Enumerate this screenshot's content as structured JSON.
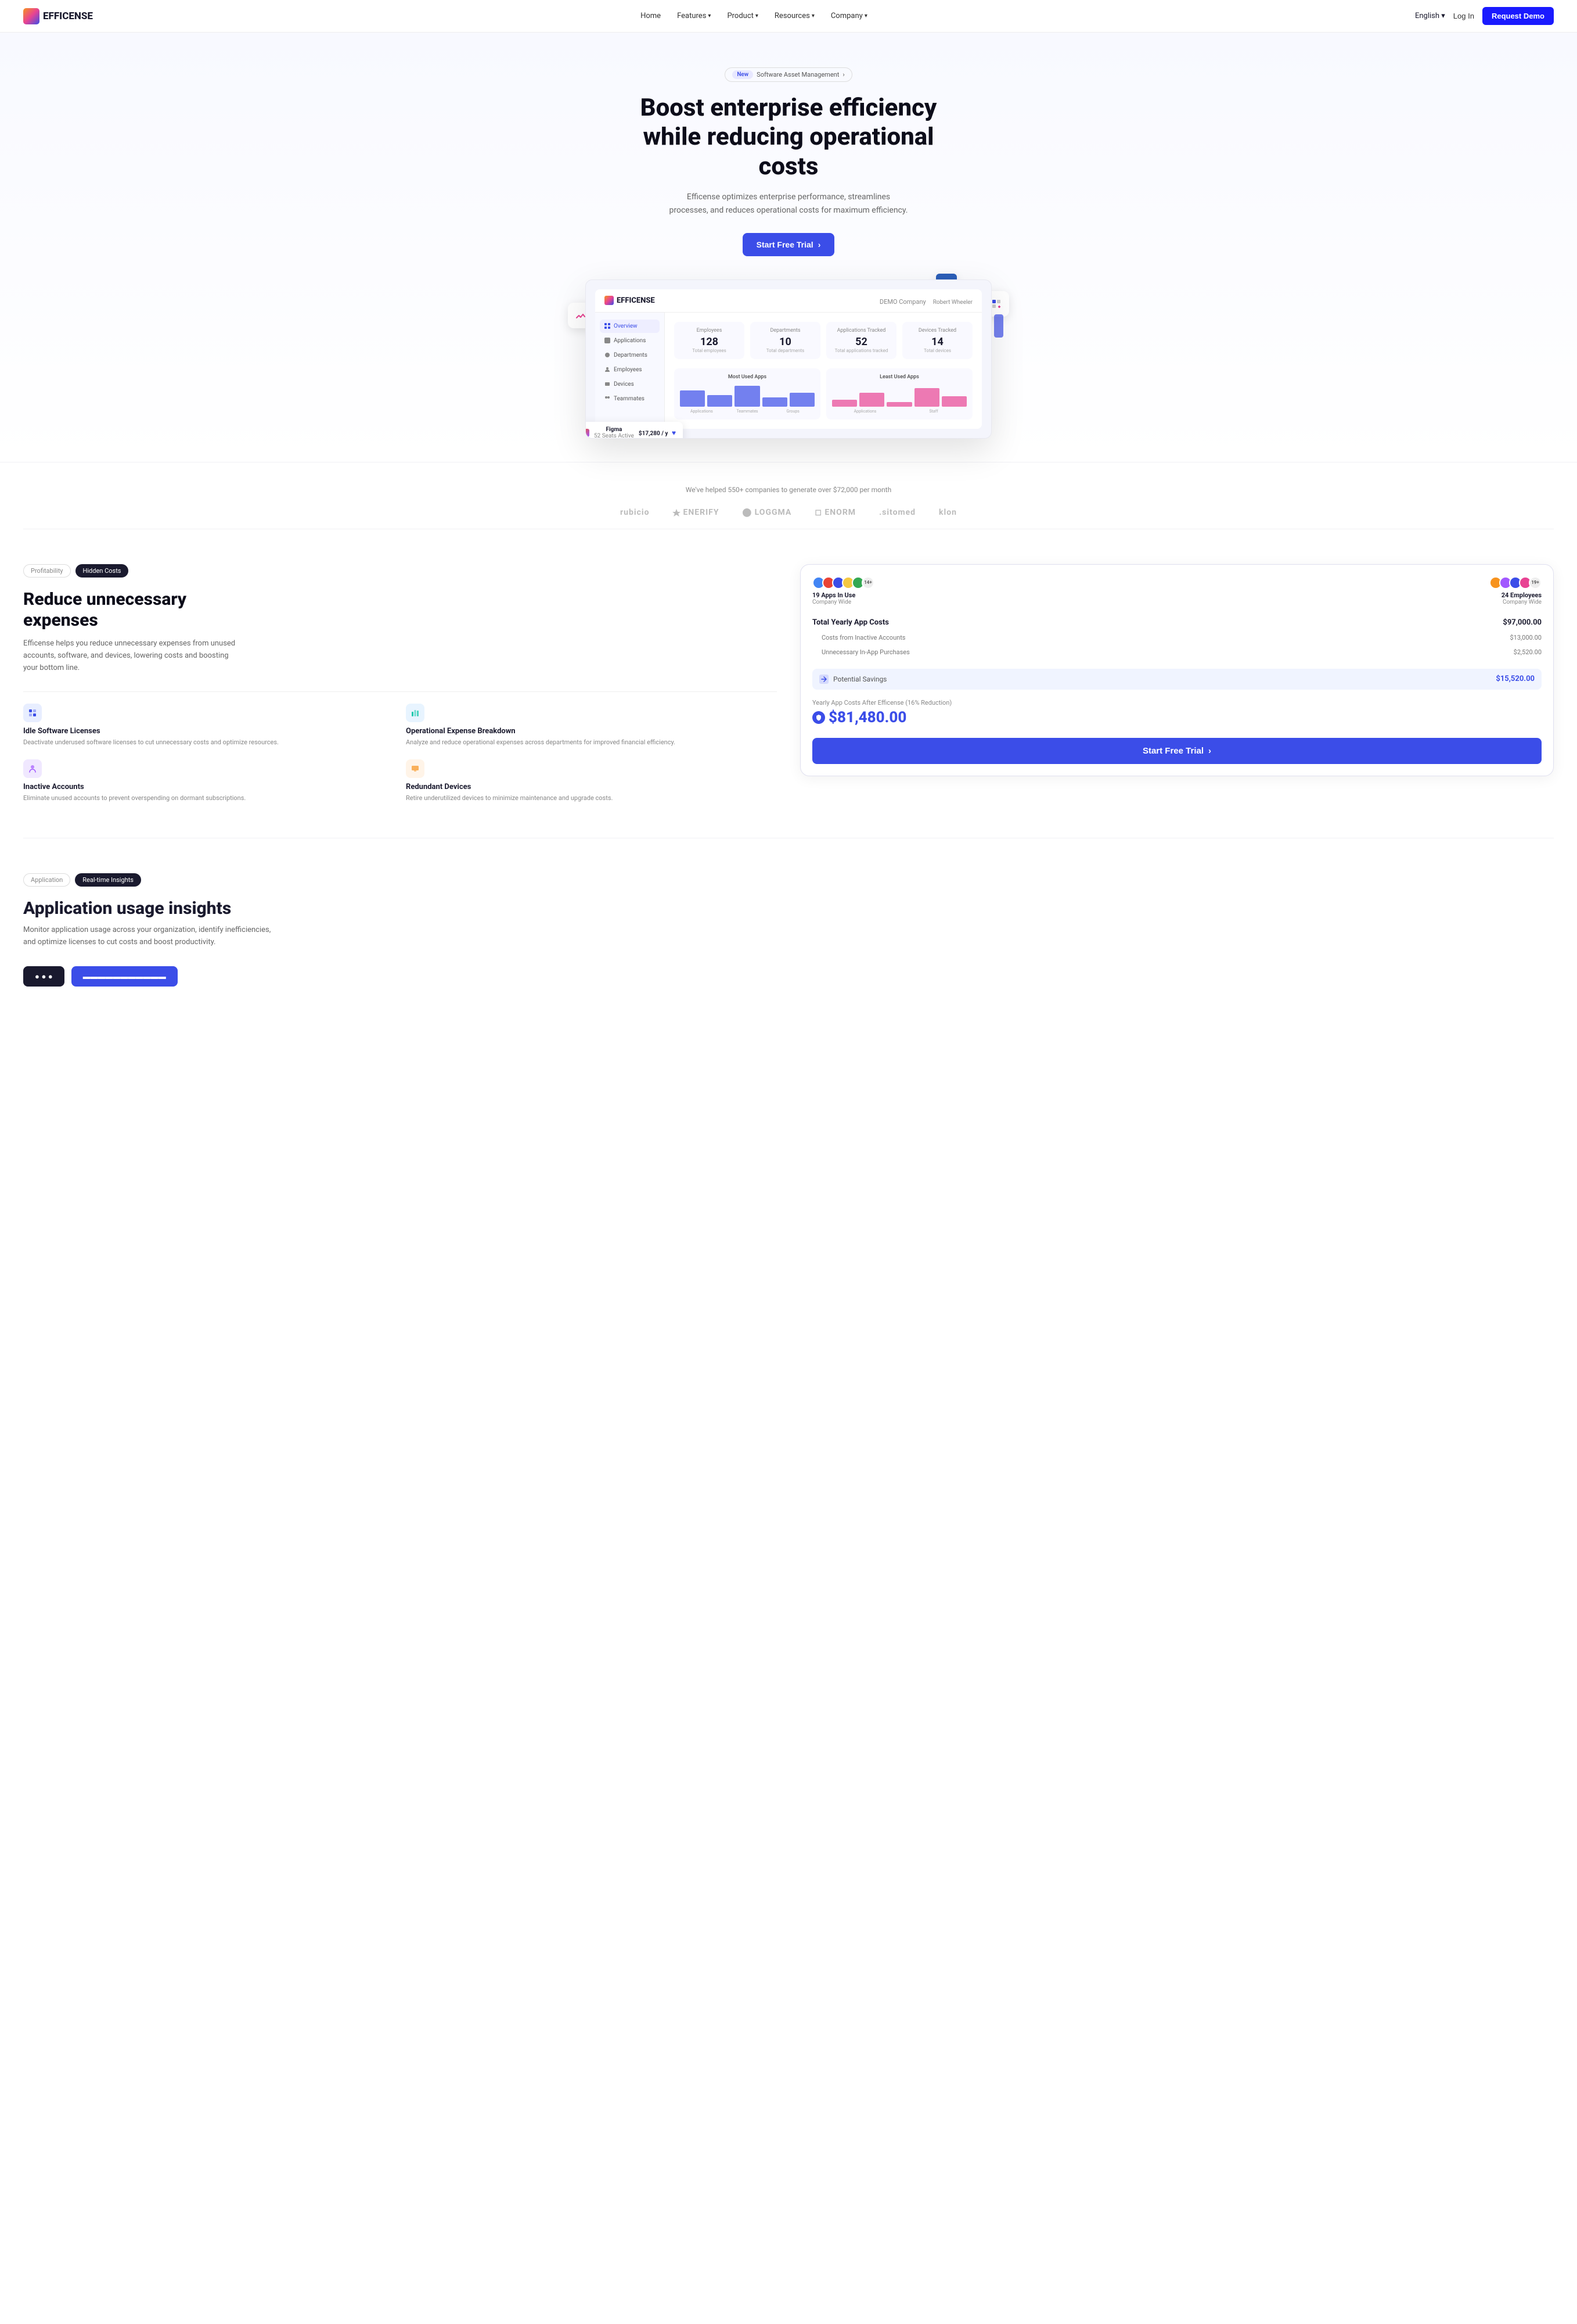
{
  "nav": {
    "logo": "EFFICENSE",
    "links": [
      {
        "label": "Home"
      },
      {
        "label": "Features",
        "hasDropdown": true
      },
      {
        "label": "Product",
        "hasDropdown": true
      },
      {
        "label": "Resources",
        "hasDropdown": true
      },
      {
        "label": "Company",
        "hasDropdown": true
      }
    ],
    "lang": "English",
    "login": "Log In",
    "demo": "Request Demo"
  },
  "hero": {
    "badge_new": "New",
    "badge_text": "Software Asset Management",
    "h1": "Boost enterprise efficiency while reducing operational costs",
    "subtitle": "Efficense optimizes enterprise performance, streamlines processes, and reduces operational costs for maximum efficiency.",
    "cta": "Start Free Trial",
    "dashboard": {
      "company": "DEMO Company",
      "user": "Robert Wheeler",
      "sidebar": [
        "Overview",
        "Applications",
        "Departments",
        "Employees",
        "Devices",
        "Teammates"
      ],
      "stats": [
        {
          "label": "Employees",
          "value": "128",
          "sub": "Total employees"
        },
        {
          "label": "Departments",
          "value": "10",
          "sub": "Total departments"
        },
        {
          "label": "Applications Tracked",
          "value": "52",
          "sub": "Total applications tracked"
        },
        {
          "label": "Devices Tracked",
          "value": "14",
          "sub": "Total devices"
        }
      ],
      "most_used": "Most Used Apps",
      "least_used": "Least Used Apps"
    },
    "figma_card": {
      "name": "Figma",
      "seats": "52 Seats Active",
      "price": "$17,280 / y"
    }
  },
  "trusted": {
    "text": "We've helped 550+ companies to generate over $72,000 per month",
    "logos": [
      "rubicio",
      "⚡ ENERIFY",
      "🔵 LOGGMA",
      "◻ ENORM",
      ".sitomed",
      "klon"
    ]
  },
  "profitability": {
    "tags": [
      "Profitability",
      "Hidden Costs"
    ],
    "active_tag": "Hidden Costs",
    "h2": "Reduce unnecessary expenses",
    "subtitle": "Efficense helps you reduce unnecessary expenses from unused accounts, software, and devices, lowering costs and boosting your bottom line.",
    "features": [
      {
        "icon_type": "blue",
        "title": "Idle Software Licenses",
        "desc": "Deactivate underused software licenses to cut unnecessary costs and optimize resources."
      },
      {
        "icon_type": "teal",
        "title": "Operational Expense Breakdown",
        "desc": "Analyze and reduce operational expenses across departments for improved financial efficiency."
      },
      {
        "icon_type": "purple",
        "title": "Inactive Accounts",
        "desc": "Eliminate unused accounts to prevent overspending on dormant subscriptions."
      },
      {
        "icon_type": "orange",
        "title": "Redundant Devices",
        "desc": "Retire underutilized devices to minimize maintenance and upgrade costs."
      }
    ],
    "cost_card": {
      "apps_in_use": "19 Apps In Use",
      "apps_sub": "Company Wide",
      "apps_count_badge": "14+",
      "employees": "24 Employees",
      "employees_sub": "Company Wide",
      "employees_count_badge": "19+",
      "total_label": "Total Yearly App Costs",
      "total_value": "$97,000.00",
      "inactive_label": "Costs from Inactive Accounts",
      "inactive_value": "$13,000.00",
      "unnecessary_label": "Unnecessary In-App Purchases",
      "unnecessary_value": "$2,520.00",
      "savings_label": "Potential Savings",
      "savings_value": "$15,520.00",
      "after_label": "Yearly App Costs After Efficense (16% Reduction)",
      "after_value": "$81,480.00",
      "cta": "Start Free Trial"
    }
  },
  "insights": {
    "tags": [
      "Application",
      "Real-time Insights"
    ],
    "active_tag": "Real-time Insights",
    "h2": "Application usage insights",
    "subtitle": "Monitor application usage across your organization, identify inefficiencies, and optimize licenses to cut costs and boost productivity.",
    "btn1": "...",
    "btn2": "..."
  }
}
